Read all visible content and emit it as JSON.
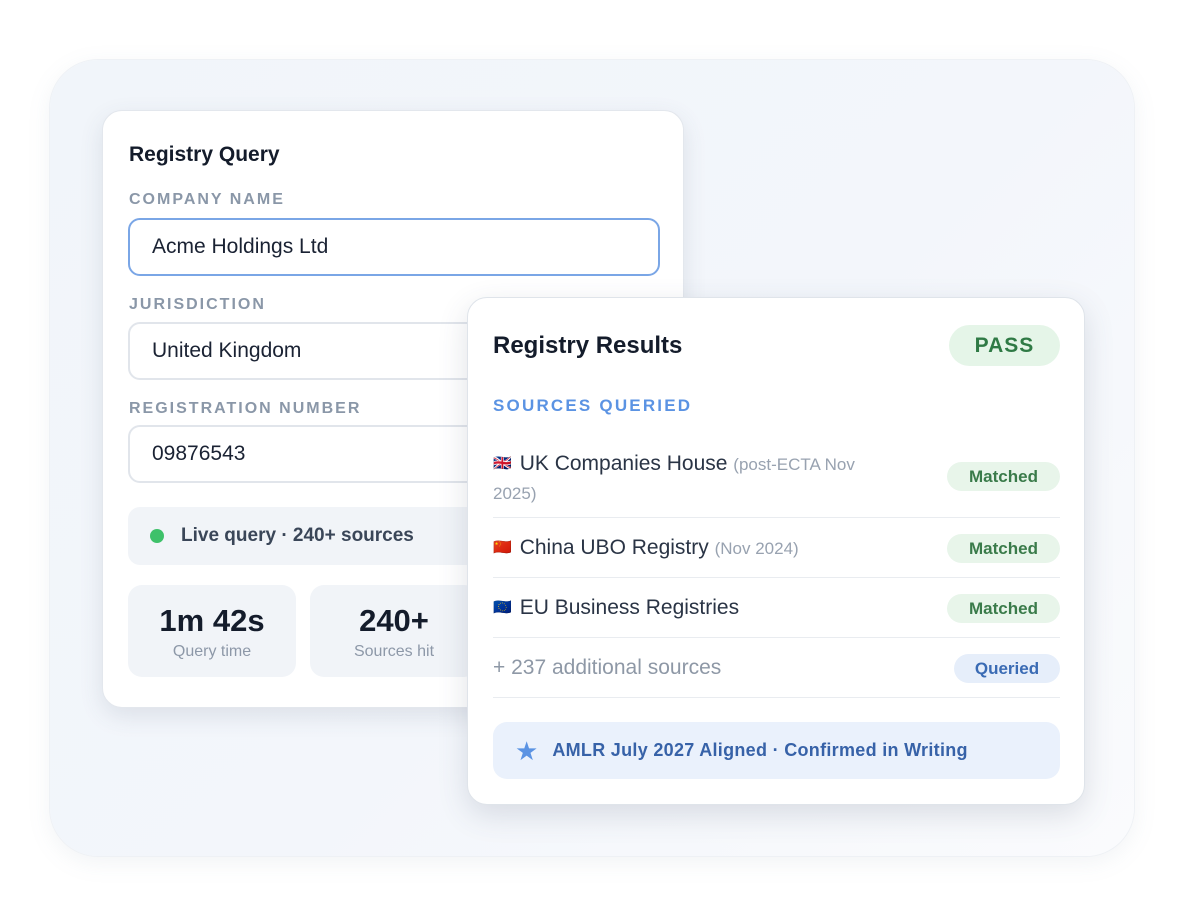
{
  "query": {
    "title": "Registry Query",
    "company_label": "COMPANY NAME",
    "company_value": "Acme Holdings Ltd",
    "jurisdiction_label": "JURISDICTION",
    "jurisdiction_value": "United Kingdom",
    "regnum_label": "REGISTRATION NUMBER",
    "regnum_value": "09876543",
    "live_status": "Live query · 240+ sources",
    "live_color": "#3ec16a",
    "stats": [
      {
        "value": "1m 42s",
        "label": "Query time"
      },
      {
        "value": "240+",
        "label": "Sources hit"
      }
    ]
  },
  "results": {
    "title": "Registry Results",
    "status": "PASS",
    "sources_heading": "SOURCES QUERIED",
    "rows": [
      {
        "flag": "🇬🇧",
        "name": "UK Companies House",
        "note": "(post-ECTA Nov",
        "note2": "2025)",
        "badge": "Matched"
      },
      {
        "flag": "🇨🇳",
        "name": "China UBO Registry",
        "note": "(Nov 2024)",
        "badge": "Matched"
      },
      {
        "flag": "🇪🇺",
        "name": "EU Business Registries",
        "note": "",
        "badge": "Matched"
      },
      {
        "name": "+ 237 additional sources",
        "badge": "Queried"
      }
    ],
    "aligned_icon": "star-icon",
    "aligned_text": "AMLR July 2027 Aligned · Confirmed in Writing"
  }
}
